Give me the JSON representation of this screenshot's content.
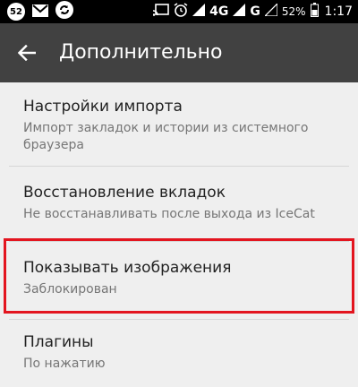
{
  "status_bar": {
    "notification_count": "52",
    "network_primary": "4G",
    "network_secondary": "G",
    "battery_percent": "52%",
    "time": "1:17"
  },
  "toolbar": {
    "title": "Дополнительно"
  },
  "settings": [
    {
      "title": "Настройки импорта",
      "summary": "Импорт закладок и истории из системного браузера"
    },
    {
      "title": "Восстановление вкладок",
      "summary": "Не восстанавливать после выхода из IceCat"
    },
    {
      "title": "Показывать изображения",
      "summary": "Заблокирован"
    },
    {
      "title": "Плагины",
      "summary": "По нажатию"
    }
  ],
  "colors": {
    "toolbar": "#414141",
    "highlight": "#e3151f"
  }
}
